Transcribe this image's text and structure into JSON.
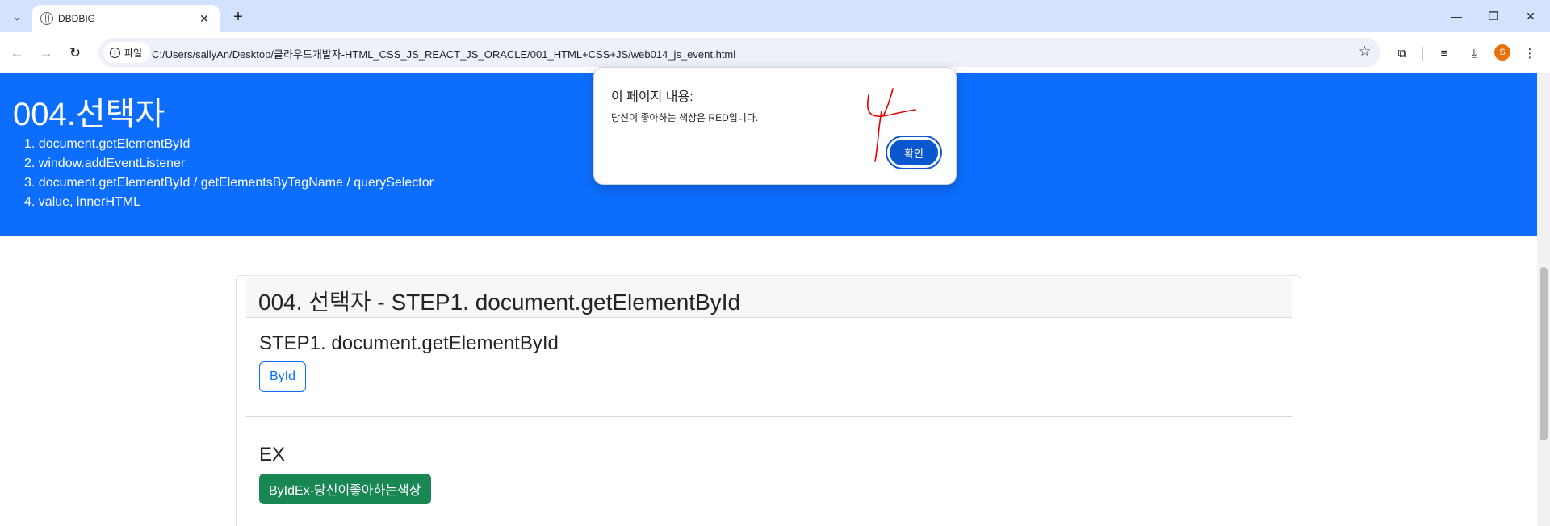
{
  "browser": {
    "tab_title": "DBDBIG",
    "site_chip_label": "파일",
    "url": "C:/Users/sallyAn/Desktop/클라우드개발자-HTML_CSS_JS_REACT_JS_ORACLE/001_HTML+CSS+JS/web014_js_event.html",
    "profile_initial": "S"
  },
  "hero": {
    "title": "004.선택자",
    "items": [
      "1. document.getElementById",
      "2. window.addEventListener",
      "3. document.getElementById / getElementsByTagName / querySelector",
      "4. value, innerHTML"
    ]
  },
  "card": {
    "header": "004. 선택자 - STEP1. document.getElementById",
    "step_title": "STEP1. document.getElementById",
    "byid_button": "ById",
    "ex_title": "EX",
    "ex_button": "ByIdEx-당신이좋아하는색상"
  },
  "alert": {
    "title": "이 페이지 내용:",
    "message": "당신이 좋아하는 색상은 RED입니다.",
    "ok_label": "확인"
  },
  "colors": {
    "hero_bg": "#0d6efd",
    "primary": "#0d6efd",
    "success": "#198754",
    "dialog_button": "#0b57d0",
    "annotation": "#e00000"
  }
}
